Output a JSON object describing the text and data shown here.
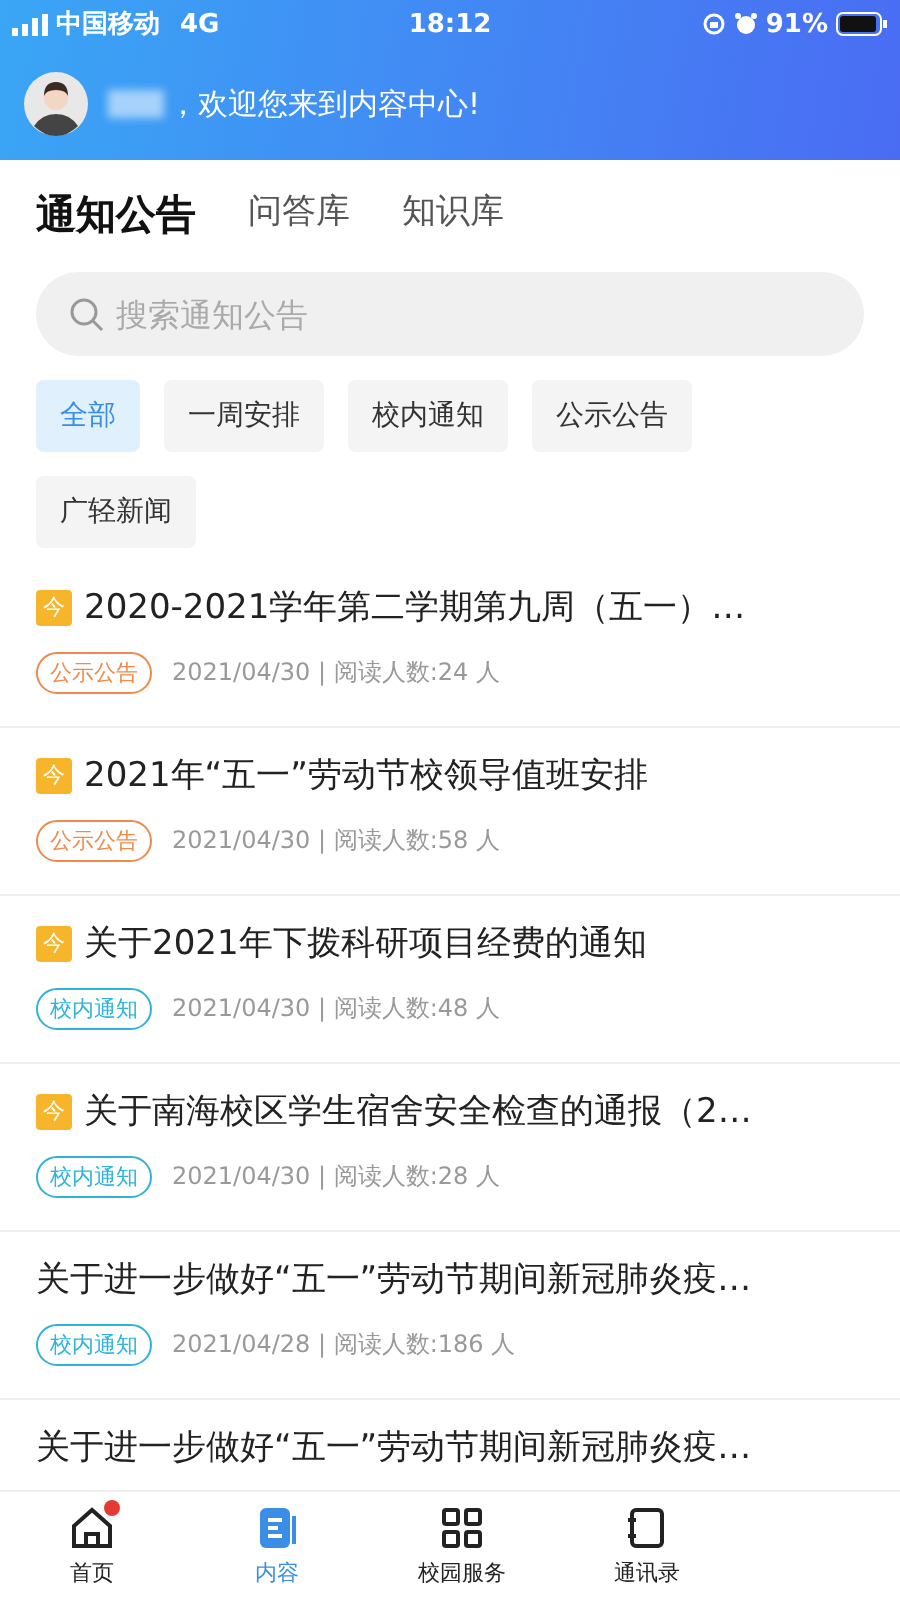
{
  "status_bar": {
    "carrier": "中国移动",
    "network": "4G",
    "time": "18:12",
    "battery": "91%"
  },
  "header": {
    "greeting": "，欢迎您来到内容中心!"
  },
  "tabs": [
    {
      "label": "通知公告",
      "selected": true
    },
    {
      "label": "问答库",
      "selected": false
    },
    {
      "label": "知识库",
      "selected": false
    }
  ],
  "search": {
    "placeholder": "搜索通知公告"
  },
  "filters": [
    {
      "label": "全部",
      "selected": true
    },
    {
      "label": "一周安排",
      "selected": false
    },
    {
      "label": "校内通知",
      "selected": false
    },
    {
      "label": "公示公告",
      "selected": false
    },
    {
      "label": "广轻新闻",
      "selected": false
    }
  ],
  "notices": [
    {
      "today": true,
      "badge": "今",
      "title": "2020-2021学年第二学期第九周（五一）…",
      "tag": {
        "label": "公示公告",
        "color": "#f08a4b"
      },
      "meta": "2021/04/30 | 阅读人数:24 人"
    },
    {
      "today": true,
      "badge": "今",
      "title": "2021年“五一”劳动节校领导值班安排",
      "tag": {
        "label": "公示公告",
        "color": "#f08a4b"
      },
      "meta": "2021/04/30 | 阅读人数:58 人"
    },
    {
      "today": true,
      "badge": "今",
      "title": "关于2021年下拨科研项目经费的通知",
      "tag": {
        "label": "校内通知",
        "color": "#2fb3d8"
      },
      "meta": "2021/04/30 | 阅读人数:48 人"
    },
    {
      "today": true,
      "badge": "今",
      "title": "关于南海校区学生宿舍安全检查的通报（2…",
      "tag": {
        "label": "校内通知",
        "color": "#2fb3d8"
      },
      "meta": "2021/04/30 | 阅读人数:28 人"
    },
    {
      "today": false,
      "title": "关于进一步做好“五一”劳动节期间新冠肺炎疫…",
      "tag": {
        "label": "校内通知",
        "color": "#2fb3d8"
      },
      "meta": "2021/04/28 | 阅读人数:186 人"
    },
    {
      "today": false,
      "title": "关于进一步做好“五一”劳动节期间新冠肺炎疫…"
    }
  ],
  "bottom_nav": [
    {
      "kind": "home",
      "label": "首页",
      "selected": false,
      "dot": true
    },
    {
      "kind": "content",
      "label": "内容",
      "selected": true,
      "dot": false
    },
    {
      "kind": "grid",
      "label": "校园服务",
      "selected": false,
      "dot": false
    },
    {
      "kind": "contacts",
      "label": "通讯录",
      "selected": false,
      "dot": false
    }
  ]
}
